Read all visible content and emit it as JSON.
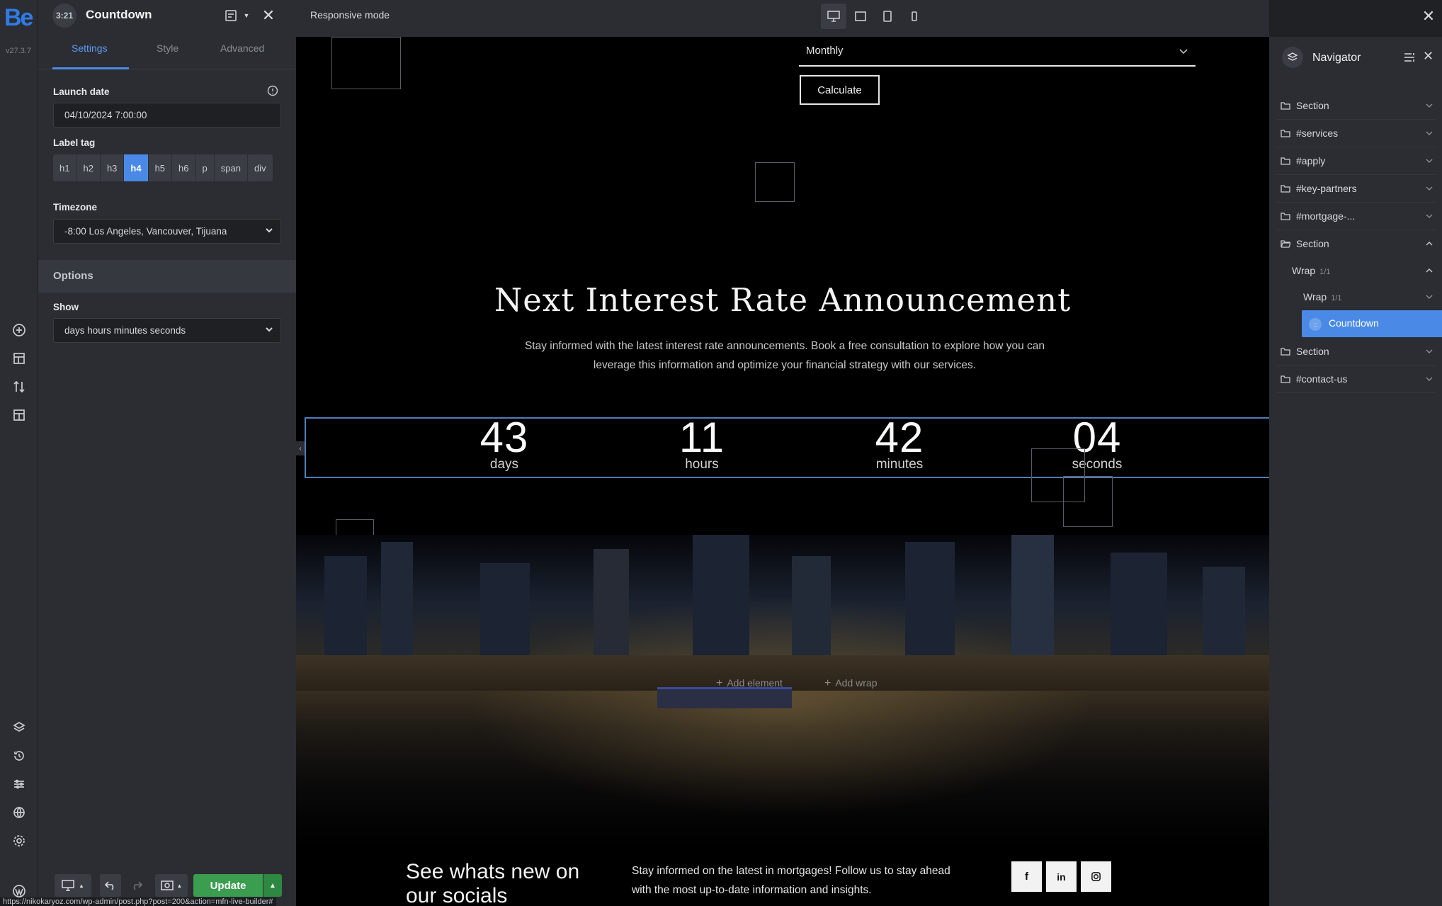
{
  "app": {
    "logo": "Be",
    "version": "v27.3.7",
    "status_url": "https://nikokaryoz.com/wp-admin/post.php?post=200&action=mfn-live-builder#"
  },
  "element": {
    "icon_glyph": "3:21",
    "title": "Countdown"
  },
  "tabs": [
    {
      "label": "Settings",
      "active": true
    },
    {
      "label": "Style",
      "active": false
    },
    {
      "label": "Advanced",
      "active": false
    }
  ],
  "settings": {
    "launch_date_label": "Launch date",
    "launch_date_value": "04/10/2024 7:00:00",
    "label_tag_label": "Label tag",
    "label_tags": [
      "h1",
      "h2",
      "h3",
      "h4",
      "h5",
      "h6",
      "p",
      "span",
      "div"
    ],
    "label_tag_active": "h4",
    "timezone_label": "Timezone",
    "timezone_value": "-8:00 Los Angeles, Vancouver, Tijuana",
    "options_header": "Options",
    "show_label": "Show",
    "show_value": "days hours minutes seconds"
  },
  "footer_bar": {
    "update_label": "Update"
  },
  "toolbar": {
    "responsive_mode": "Responsive mode",
    "devices": [
      "desktop",
      "laptop",
      "tablet",
      "mobile"
    ],
    "active_device": "desktop"
  },
  "canvas": {
    "select_value": "Monthly",
    "calculate_label": "Calculate",
    "headline": "Next Interest Rate Announcement",
    "subline": "Stay informed with the latest interest rate announcements. Book a free consultation to explore how you can leverage this information and optimize your financial strategy with our services.",
    "countdown": [
      {
        "value": "43",
        "unit": "days"
      },
      {
        "value": "11",
        "unit": "hours"
      },
      {
        "value": "42",
        "unit": "minutes"
      },
      {
        "value": "04",
        "unit": "seconds"
      }
    ],
    "add_element": "Add element",
    "add_wrap": "Add wrap",
    "socials_heading": "See whats new on our socials",
    "socials_text": "Stay informed on the latest in mortgages! Follow us to stay ahead with the most up-to-date information and insights.",
    "social_icons": [
      "facebook-icon",
      "linkedin-icon",
      "instagram-icon"
    ]
  },
  "navigator": {
    "title": "Navigator",
    "items": [
      {
        "label": "Section",
        "level": 0,
        "open": false
      },
      {
        "label": "#services",
        "level": 0,
        "open": false
      },
      {
        "label": "#apply",
        "level": 0,
        "open": false
      },
      {
        "label": "#key-partners",
        "level": 0,
        "open": false
      },
      {
        "label": "#mortgage-...",
        "level": 0,
        "open": false
      },
      {
        "label": "Section",
        "level": 0,
        "open": true
      },
      {
        "label": "Wrap",
        "badge": "1/1",
        "level": 1,
        "open": true
      },
      {
        "label": "Wrap",
        "badge": "1/1",
        "level": 2,
        "open": false
      },
      {
        "label": "Countdown",
        "level": 3,
        "selected": true
      },
      {
        "label": "Section",
        "level": 0,
        "open": false
      },
      {
        "label": "#contact-us",
        "level": 0,
        "open": false
      }
    ]
  },
  "colors": {
    "accent": "#4a8ae6",
    "update_green": "#3a9d4f",
    "panel_bg": "#2b2d32",
    "canvas_bg": "#000000"
  }
}
